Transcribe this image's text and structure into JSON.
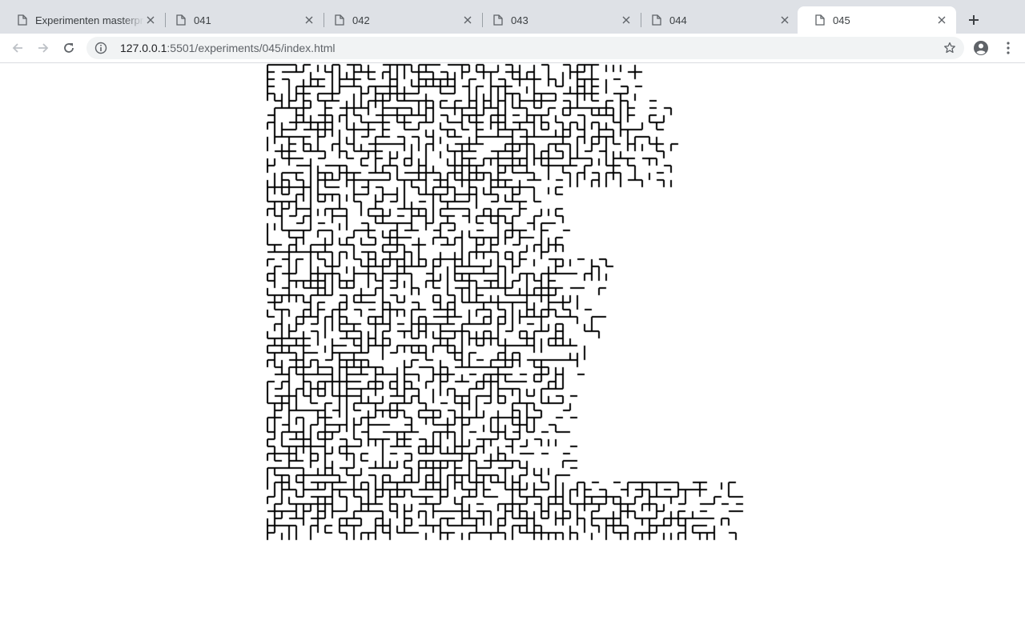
{
  "browser": {
    "tabs": [
      {
        "title": "Experimenten masterproef",
        "active": false
      },
      {
        "title": "041",
        "active": false
      },
      {
        "title": "042",
        "active": false
      },
      {
        "title": "043",
        "active": false
      },
      {
        "title": "044",
        "active": false
      },
      {
        "title": "045",
        "active": true
      }
    ],
    "address": {
      "host": "127.0.0.1",
      "rest": ":5501/experiments/045/index.html"
    }
  },
  "colors": {
    "tabstrip": "#dee1e6",
    "omnibox": "#f1f3f4",
    "icon": "#5f6368",
    "icon_disabled": "#bdc1c6",
    "maze_stroke": "#000000"
  },
  "icons": [
    "doc-icon",
    "close-icon",
    "plus-icon",
    "back-arrow-icon",
    "forward-arrow-icon",
    "reload-icon",
    "info-icon",
    "star-icon",
    "profile-icon",
    "kebab-menu-icon"
  ]
}
